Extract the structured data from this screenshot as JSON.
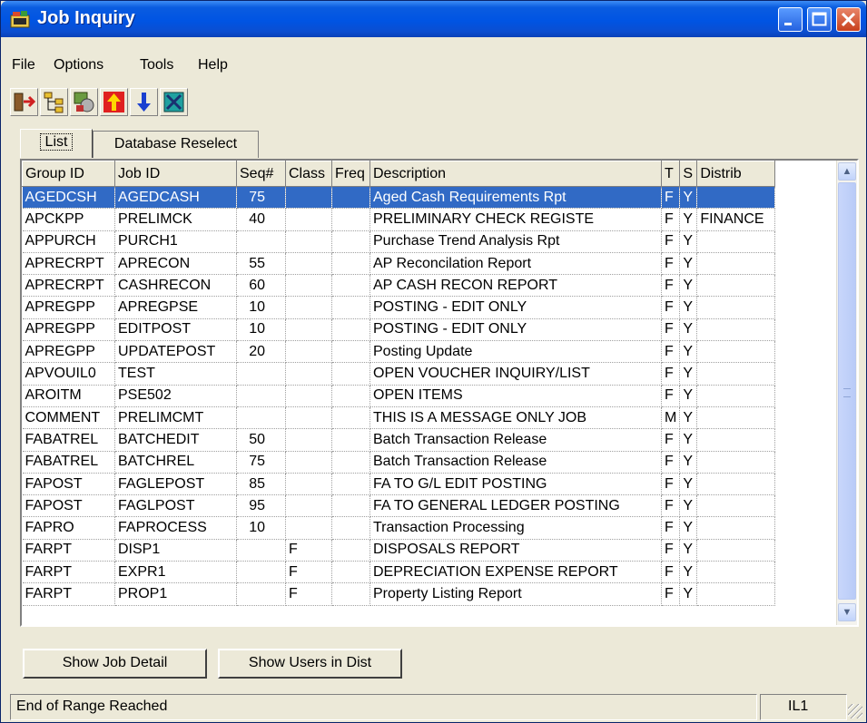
{
  "window": {
    "title": "Job Inquiry"
  },
  "menu": [
    "File",
    "Options",
    "Tools",
    "Help"
  ],
  "toolbar": [
    {
      "icon": "exit-icon"
    },
    {
      "icon": "tree-icon"
    },
    {
      "icon": "settings-icon"
    },
    {
      "icon": "arrow-up-icon"
    },
    {
      "icon": "arrow-down-icon"
    },
    {
      "icon": "tools-icon"
    }
  ],
  "tabs": [
    "List",
    "Database Reselect"
  ],
  "columns": [
    "Group ID",
    "Job ID",
    "Seq#",
    "Class",
    "Freq",
    "Description",
    "T",
    "S",
    "Distrib"
  ],
  "rows": [
    [
      "AGEDCSH",
      "AGEDCASH",
      "75",
      "",
      "",
      "Aged Cash Requirements Rpt",
      "F",
      "Y",
      ""
    ],
    [
      "APCKPP",
      "PRELIMCK",
      "40",
      "",
      "",
      "PRELIMINARY CHECK REGISTE",
      "F",
      "Y",
      "FINANCE"
    ],
    [
      "APPURCH",
      "PURCH1",
      "",
      "",
      "",
      "Purchase Trend Analysis Rpt",
      "F",
      "Y",
      ""
    ],
    [
      "APRECRPT",
      "APRECON",
      "55",
      "",
      "",
      "AP Reconcilation Report",
      "F",
      "Y",
      ""
    ],
    [
      "APRECRPT",
      "CASHRECON",
      "60",
      "",
      "",
      "AP CASH RECON REPORT",
      "F",
      "Y",
      ""
    ],
    [
      "APREGPP",
      "APREGPSE",
      "10",
      "",
      "",
      "POSTING - EDIT ONLY",
      "F",
      "Y",
      ""
    ],
    [
      "APREGPP",
      "EDITPOST",
      "10",
      "",
      "",
      "POSTING - EDIT ONLY",
      "F",
      "Y",
      ""
    ],
    [
      "APREGPP",
      "UPDATEPOST",
      "20",
      "",
      "",
      "Posting Update",
      "F",
      "Y",
      ""
    ],
    [
      "APVOUIL0",
      "TEST",
      "",
      "",
      "",
      "OPEN VOUCHER INQUIRY/LIST",
      "F",
      "Y",
      ""
    ],
    [
      "AROITM",
      "PSE502",
      "",
      "",
      "",
      "OPEN ITEMS",
      "F",
      "Y",
      ""
    ],
    [
      "COMMENT",
      "PRELIMCMT",
      "",
      "",
      "",
      "THIS IS A MESSAGE ONLY JOB",
      "M",
      "Y",
      ""
    ],
    [
      "FABATREL",
      "BATCHEDIT",
      "50",
      "",
      "",
      "Batch Transaction Release",
      "F",
      "Y",
      ""
    ],
    [
      "FABATREL",
      "BATCHREL",
      "75",
      "",
      "",
      "Batch Transaction Release",
      "F",
      "Y",
      ""
    ],
    [
      "FAPOST",
      "FAGLEPOST",
      "85",
      "",
      "",
      "FA TO G/L EDIT POSTING",
      "F",
      "Y",
      ""
    ],
    [
      "FAPOST",
      "FAGLPOST",
      "95",
      "",
      "",
      "FA TO GENERAL LEDGER POSTING",
      "F",
      "Y",
      ""
    ],
    [
      "FAPRO",
      "FAPROCESS",
      "10",
      "",
      "",
      "Transaction Processing",
      "F",
      "Y",
      ""
    ],
    [
      "FARPT",
      "DISP1",
      "",
      "F",
      "",
      "DISPOSALS REPORT",
      "F",
      "Y",
      ""
    ],
    [
      "FARPT",
      "EXPR1",
      "",
      "F",
      "",
      "DEPRECIATION EXPENSE REPORT",
      "F",
      "Y",
      ""
    ],
    [
      "FARPT",
      "PROP1",
      "",
      "F",
      "",
      "Property Listing Report",
      "F",
      "Y",
      ""
    ]
  ],
  "selected_row": 0,
  "buttons": {
    "show_job_detail": "Show Job Detail",
    "show_users": "Show Users in Dist"
  },
  "status": {
    "message": "End of Range Reached",
    "code": "IL1"
  },
  "colors": {
    "titlebar": "#0054e3",
    "selection": "#316ac5",
    "chrome": "#ece9d8"
  }
}
